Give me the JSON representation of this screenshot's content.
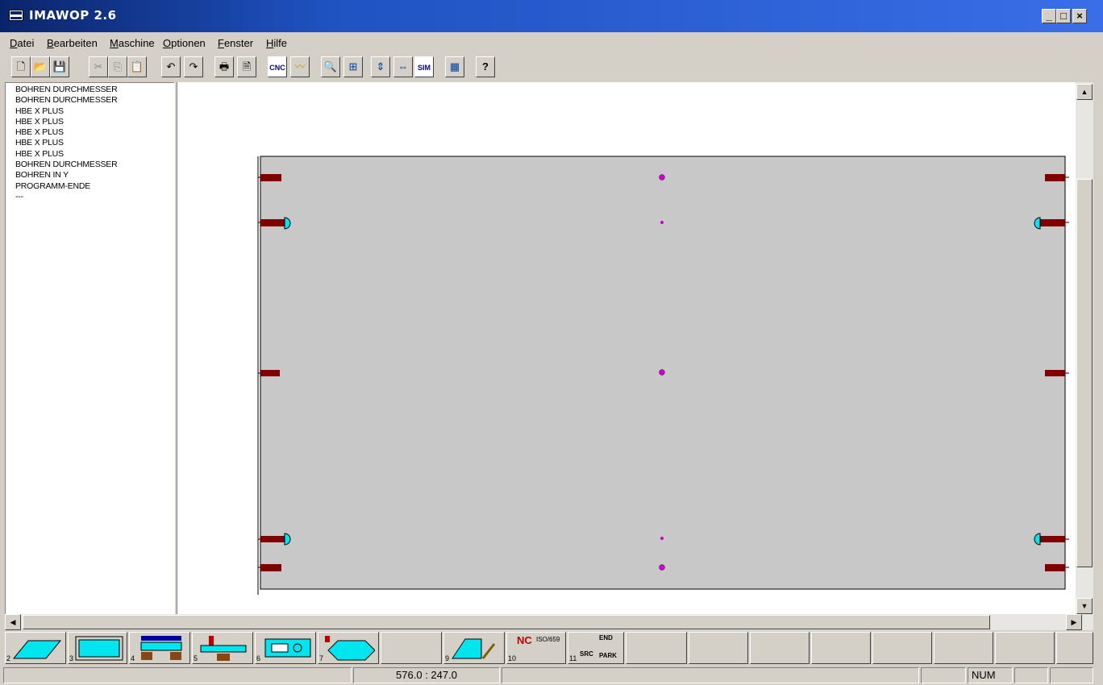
{
  "window": {
    "title": "IMAWOP  2.6",
    "controls": {
      "minimize": "_",
      "maximize": "□",
      "close": "×"
    }
  },
  "menu": {
    "items": [
      "Datei",
      "Bearbeiten",
      "Maschine",
      "Optionen",
      "Fenster",
      "Hilfe"
    ],
    "mnemonics": [
      "D",
      "B",
      "M",
      "O",
      "F",
      "H"
    ]
  },
  "toolbar": {
    "buttons": [
      {
        "icon": "new-file-icon",
        "glyph": "🗋"
      },
      {
        "icon": "open-folder-icon",
        "glyph": "📂"
      },
      {
        "icon": "save-icon",
        "glyph": "💾",
        "disabled": true
      },
      {
        "icon": "cut-icon",
        "glyph": "✂",
        "disabled": true
      },
      {
        "icon": "copy-icon",
        "glyph": "⎘",
        "disabled": true
      },
      {
        "icon": "paste-icon",
        "glyph": "📋",
        "disabled": true
      },
      {
        "icon": "undo-icon",
        "glyph": "↶"
      },
      {
        "icon": "redo-icon",
        "glyph": "↷"
      },
      {
        "icon": "print-icon",
        "glyph": "🖶"
      },
      {
        "icon": "print-preview-icon",
        "glyph": "🗎"
      },
      {
        "icon": "cnc-icon",
        "label": "CNC"
      },
      {
        "icon": "path-icon",
        "glyph": "〰"
      },
      {
        "icon": "zoom-icon",
        "glyph": "🔍"
      },
      {
        "icon": "zoom-window-icon",
        "glyph": "⊞"
      },
      {
        "icon": "fit-height-icon",
        "glyph": "⇕"
      },
      {
        "icon": "fit-width-icon",
        "glyph": "⇔"
      },
      {
        "icon": "simulation-icon",
        "label": "SIM"
      },
      {
        "icon": "calculator-icon",
        "glyph": "▦"
      },
      {
        "icon": "help-icon",
        "glyph": "?"
      }
    ]
  },
  "program_list": [
    "BOHREN DURCHMESSER",
    "BOHREN DURCHMESSER",
    "HBE X PLUS",
    "HBE X PLUS",
    "HBE X PLUS",
    "HBE X PLUS",
    "HBE X PLUS",
    "BOHREN DURCHMESSER",
    "BOHREN IN Y",
    "PROGRAMM-ENDE",
    "---"
  ],
  "colors": {
    "panel_fill": "#c8c8c8",
    "slot": "#800000",
    "hole": "#cc00cc",
    "dowel": "#00e5ee",
    "title_bar": "#0a246a"
  },
  "function_buttons": [
    {
      "num": "2",
      "icon": "panel-plate-icon"
    },
    {
      "num": "3",
      "icon": "panel-frame-icon"
    },
    {
      "num": "4",
      "icon": "drilling-unit-icon"
    },
    {
      "num": "5",
      "icon": "horizontal-drilling-icon"
    },
    {
      "num": "6",
      "icon": "milling-panel-icon"
    },
    {
      "num": "7",
      "icon": "edge-cut-icon"
    },
    {
      "num": "",
      "icon": "empty-slot"
    },
    {
      "num": "9",
      "icon": "tool-change-icon"
    },
    {
      "num": "10",
      "icon": "nc-iso-icon",
      "label": "NC",
      "sublabel": "ISO/659"
    },
    {
      "num": "11",
      "icon": "end-park-icon",
      "label": "END",
      "sublabel": "PARK",
      "extra": "SRC"
    }
  ],
  "status": {
    "coordinates": "576.0 : 247.0",
    "num_indicator": "NUM"
  }
}
